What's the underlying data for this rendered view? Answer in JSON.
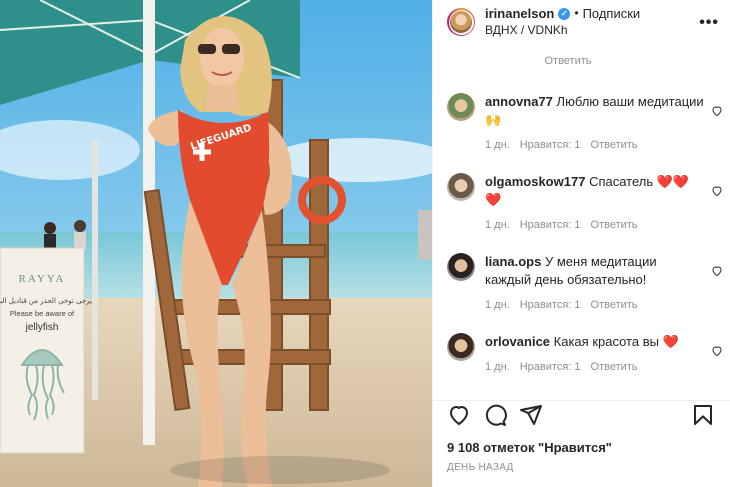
{
  "header": {
    "username": "irinanelson",
    "verified_glyph": "✓",
    "separator": "•",
    "follow_label": "Подписки",
    "location": "ВДНХ / VDNKh",
    "more_glyph": "•••"
  },
  "reply_top": "Ответить",
  "comments": [
    {
      "user": "annovna77",
      "text": "Люблю ваши медитации 🙌",
      "age": "1 дн.",
      "likes": "Нравится: 1",
      "reply": "Ответить"
    },
    {
      "user": "olgamoskow177",
      "text": "Спасатель ❤️❤️❤️",
      "age": "1 дн.",
      "likes": "Нравится: 1",
      "reply": "Ответить"
    },
    {
      "user": "liana.ops",
      "text": "У меня медитации каждый день обязательно!",
      "age": "1 дн.",
      "likes": "Нравится: 1",
      "reply": "Ответить"
    },
    {
      "user": "orlovanice",
      "text": "Какая красота вы ❤️",
      "age": "1 дн.",
      "likes": "Нравится: 1",
      "reply": "Ответить"
    }
  ],
  "likes_text": "9 108 отметок \"Нравится\"",
  "time_text": "ДЕНЬ НАЗАД",
  "photo": {
    "sign_brand": "RAYYA",
    "sign_arabic": "يرجى توخي الحذر من قناديل البحر",
    "sign_line1": "Please be aware of",
    "sign_line2": "jellyfish",
    "swimsuit_text": "LIFEGUARD"
  },
  "icons": {
    "like": "heart-outline-icon",
    "comment": "comment-bubble-icon",
    "share": "paper-plane-icon",
    "save": "bookmark-icon"
  },
  "colors": {
    "text": "#262626",
    "muted": "#8e8e8e",
    "verified": "#3897f0",
    "heart": "#ed4956",
    "swimsuit": "#e34b2e"
  }
}
